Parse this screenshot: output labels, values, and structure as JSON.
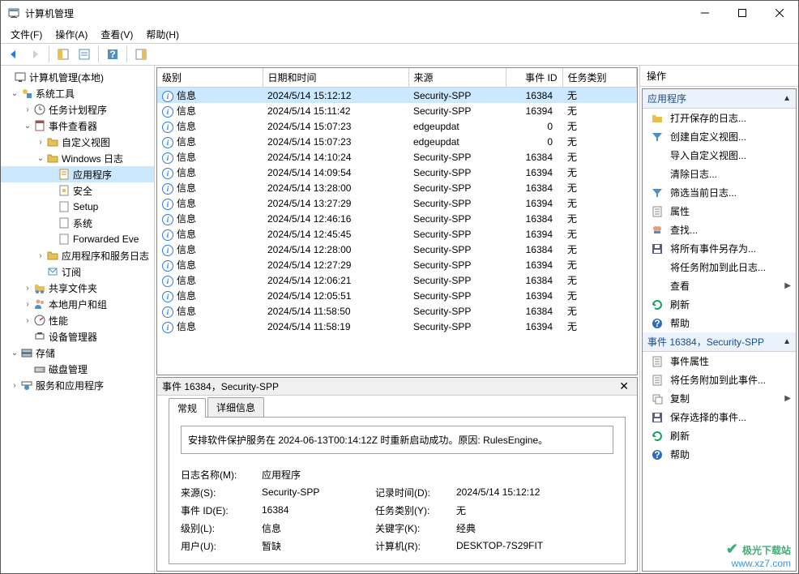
{
  "window": {
    "title": "计算机管理"
  },
  "menu": {
    "file": "文件(F)",
    "action": "操作(A)",
    "view": "查看(V)",
    "help": "帮助(H)"
  },
  "tree": {
    "root": "计算机管理(本地)",
    "systools": "系统工具",
    "scheduler": "任务计划程序",
    "eventviewer": "事件查看器",
    "customviews": "自定义视图",
    "winlogs": "Windows 日志",
    "application": "应用程序",
    "security": "安全",
    "setup": "Setup",
    "system": "系统",
    "forwarded": "Forwarded Eve",
    "appservices": "应用程序和服务日志",
    "subscriptions": "订阅",
    "sharedfolders": "共享文件夹",
    "localusers": "本地用户和组",
    "performance": "性能",
    "devicemgr": "设备管理器",
    "storage": "存储",
    "diskmgr": "磁盘管理",
    "services": "服务和应用程序"
  },
  "grid": {
    "headers": {
      "level": "级别",
      "datetime": "日期和时间",
      "source": "来源",
      "eventid": "事件 ID",
      "taskcat": "任务类别"
    },
    "rows": [
      {
        "level": "信息",
        "dt": "2024/5/14 15:12:12",
        "src": "Security-SPP",
        "id": "16384",
        "cat": "无",
        "selected": true
      },
      {
        "level": "信息",
        "dt": "2024/5/14 15:11:42",
        "src": "Security-SPP",
        "id": "16394",
        "cat": "无"
      },
      {
        "level": "信息",
        "dt": "2024/5/14 15:07:23",
        "src": "edgeupdat",
        "id": "0",
        "cat": "无"
      },
      {
        "level": "信息",
        "dt": "2024/5/14 15:07:23",
        "src": "edgeupdat",
        "id": "0",
        "cat": "无"
      },
      {
        "level": "信息",
        "dt": "2024/5/14 14:10:24",
        "src": "Security-SPP",
        "id": "16384",
        "cat": "无"
      },
      {
        "level": "信息",
        "dt": "2024/5/14 14:09:54",
        "src": "Security-SPP",
        "id": "16394",
        "cat": "无"
      },
      {
        "level": "信息",
        "dt": "2024/5/14 13:28:00",
        "src": "Security-SPP",
        "id": "16384",
        "cat": "无"
      },
      {
        "level": "信息",
        "dt": "2024/5/14 13:27:29",
        "src": "Security-SPP",
        "id": "16394",
        "cat": "无"
      },
      {
        "level": "信息",
        "dt": "2024/5/14 12:46:16",
        "src": "Security-SPP",
        "id": "16384",
        "cat": "无"
      },
      {
        "level": "信息",
        "dt": "2024/5/14 12:45:45",
        "src": "Security-SPP",
        "id": "16394",
        "cat": "无"
      },
      {
        "level": "信息",
        "dt": "2024/5/14 12:28:00",
        "src": "Security-SPP",
        "id": "16384",
        "cat": "无"
      },
      {
        "level": "信息",
        "dt": "2024/5/14 12:27:29",
        "src": "Security-SPP",
        "id": "16394",
        "cat": "无"
      },
      {
        "level": "信息",
        "dt": "2024/5/14 12:06:21",
        "src": "Security-SPP",
        "id": "16384",
        "cat": "无"
      },
      {
        "level": "信息",
        "dt": "2024/5/14 12:05:51",
        "src": "Security-SPP",
        "id": "16394",
        "cat": "无"
      },
      {
        "level": "信息",
        "dt": "2024/5/14 11:58:50",
        "src": "Security-SPP",
        "id": "16384",
        "cat": "无"
      },
      {
        "level": "信息",
        "dt": "2024/5/14 11:58:19",
        "src": "Security-SPP",
        "id": "16394",
        "cat": "无"
      }
    ]
  },
  "details": {
    "title": "事件 16384，Security-SPP",
    "tabs": {
      "general": "常规",
      "details": "详细信息"
    },
    "message": "安排软件保护服务在 2024-06-13T00:14:12Z 时重新启动成功。原因: RulesEngine。",
    "labels": {
      "logname": "日志名称(M):",
      "source": "来源(S):",
      "eventid": "事件 ID(E):",
      "level": "级别(L):",
      "user": "用户(U):",
      "logged": "记录时间(D):",
      "taskcat": "任务类别(Y):",
      "keywords": "关键字(K):",
      "computer": "计算机(R):"
    },
    "values": {
      "logname": "应用程序",
      "source": "Security-SPP",
      "eventid": "16384",
      "level": "信息",
      "user": "暂缺",
      "logged": "2024/5/14 15:12:12",
      "taskcat": "无",
      "keywords": "经典",
      "computer": "DESKTOP-7S29FIT"
    }
  },
  "actions": {
    "header": "操作",
    "group1": "应用程序",
    "items1": [
      {
        "k": "open",
        "label": "打开保存的日志...",
        "color": "#e8c050"
      },
      {
        "k": "customview",
        "label": "创建自定义视图...",
        "color": "#5090c0"
      },
      {
        "k": "importview",
        "label": "导入自定义视图...",
        "color": ""
      },
      {
        "k": "clearlog",
        "label": "清除日志...",
        "color": ""
      },
      {
        "k": "filter",
        "label": "筛选当前日志...",
        "color": "#5090c0"
      },
      {
        "k": "props",
        "label": "属性",
        "color": "#888"
      },
      {
        "k": "find",
        "label": "查找...",
        "color": "#444"
      },
      {
        "k": "saveas",
        "label": "将所有事件另存为...",
        "color": "#444"
      },
      {
        "k": "attachtask",
        "label": "将任务附加到此日志...",
        "color": ""
      },
      {
        "k": "view",
        "label": "查看",
        "color": "",
        "arrow": true
      },
      {
        "k": "refresh",
        "label": "刷新",
        "color": "#20a060"
      },
      {
        "k": "help",
        "label": "帮助",
        "color": "#2c6cc0"
      }
    ],
    "group2": "事件 16384，Security-SPP",
    "items2": [
      {
        "k": "eventprops",
        "label": "事件属性",
        "color": "#888"
      },
      {
        "k": "attachtaskevent",
        "label": "将任务附加到此事件...",
        "color": "#888"
      },
      {
        "k": "copy",
        "label": "复制",
        "color": "#888",
        "arrow": true
      },
      {
        "k": "savesel",
        "label": "保存选择的事件...",
        "color": "#444"
      },
      {
        "k": "refresh2",
        "label": "刷新",
        "color": "#20a060"
      },
      {
        "k": "help2",
        "label": "帮助",
        "color": "#2c6cc0"
      }
    ]
  },
  "watermark": {
    "name": "极光下载站",
    "url": "www.xz7.com"
  }
}
